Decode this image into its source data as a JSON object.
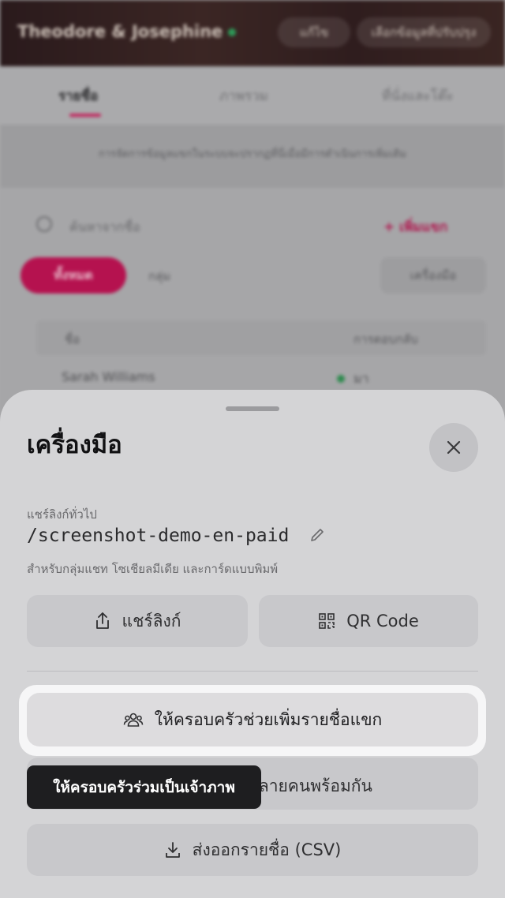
{
  "background": {
    "event_title": "Theodore & Josephine",
    "hero_buttons": [
      "แก้ไข",
      "เลือกข้อมูลที่ปรับปรุง"
    ],
    "tabs": [
      {
        "label": "รายชื่อ",
        "active": true
      },
      {
        "label": "ภาพรวม",
        "active": false
      },
      {
        "label": "ที่นั่งและโต๊ะ",
        "active": false
      }
    ],
    "notice": "การจัดการข้อมูลแขกในระบบจะปรากฏที่นี่เมื่อมีการดำเนินการเพิ่มเติม",
    "search_placeholder": "ค้นหาจากชื่อ",
    "add_guest": "+ เพิ่มแขก",
    "filter_pill": "ทั้งหมด",
    "group_dropdown": "กลุ่ม",
    "tools_button": "เครื่องมือ",
    "table_headers": [
      "ชื่อ",
      "การตอบกลับ"
    ],
    "first_row": {
      "name": "Sarah Williams",
      "status": "มา"
    }
  },
  "sheet": {
    "title": "เครื่องมือ",
    "share_label": "แชร์ลิงก์ทั่วไป",
    "share_path": "/screenshot-demo-en-paid",
    "share_description": "สำหรับกลุ่มแชท โซเชียลมีเดีย และการ์ดแบบพิมพ์",
    "share_link_button": "แชร์ลิงก์",
    "qr_code_button": "QR Code",
    "family_add_button": "ให้ครอบครัวช่วยเพิ่มรายชื่อแขก",
    "add_multiple_button": "หลายคนพร้อมกัน",
    "export_csv_button": "ส่งออกรายชื่อ (CSV)"
  },
  "tooltip": {
    "text": "ให้ครอบครัวร่วมเป็นเจ้าภาพ"
  },
  "colors": {
    "accent": "#b5124f",
    "sheet_bg": "#d4d4d6",
    "tooltip_bg": "#1e1e20"
  },
  "icons": [
    "search-icon",
    "plus-icon",
    "close-icon",
    "pencil-icon",
    "share-icon",
    "qr-code-icon",
    "users-icon",
    "download-icon"
  ]
}
